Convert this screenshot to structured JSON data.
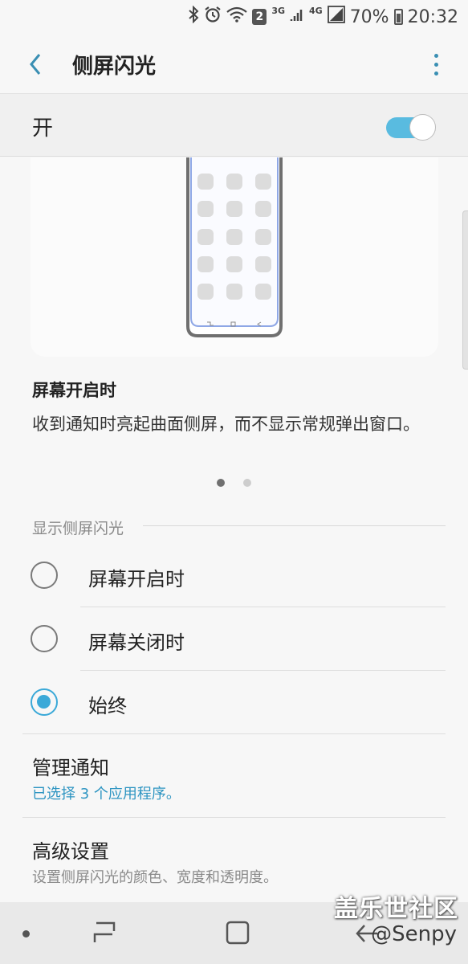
{
  "status_bar": {
    "network_badge": "2",
    "net_3g": "3G",
    "net_4g": "4G",
    "battery": "70%",
    "time": "20:32",
    "battery_level": 0.7,
    "icons": [
      "bluetooth-icon",
      "alarm-icon",
      "wifi-icon",
      "signal-icon",
      "battery-icon"
    ]
  },
  "app_bar": {
    "title": "侧屏闪光",
    "back_icon": "chevron-left-icon",
    "more_icon": "more-vertical-icon"
  },
  "master_switch": {
    "label": "开",
    "on": true
  },
  "tip": {
    "title": "屏幕开启时",
    "text": "收到通知时亮起曲面侧屏，而不显示常规弹出窗口。",
    "page": 1,
    "pages": 2
  },
  "section": {
    "header": "显示侧屏闪光",
    "options": [
      {
        "label": "屏幕开启时",
        "checked": false
      },
      {
        "label": "屏幕关闭时",
        "checked": false
      },
      {
        "label": "始终",
        "checked": true
      }
    ]
  },
  "prefs": {
    "manage": {
      "title": "管理通知",
      "subtitle": "已选择 3 个应用程序。"
    },
    "advanced": {
      "title": "高级设置",
      "subtitle": "设置侧屏闪光的颜色、宽度和透明度。"
    }
  },
  "overlay": {
    "watermark": "盖乐世社区",
    "handle": "@Senpy"
  },
  "colors": {
    "accent": "#3ba9d8",
    "toggle_track": "#59bbe0",
    "link": "#2e95c2"
  }
}
